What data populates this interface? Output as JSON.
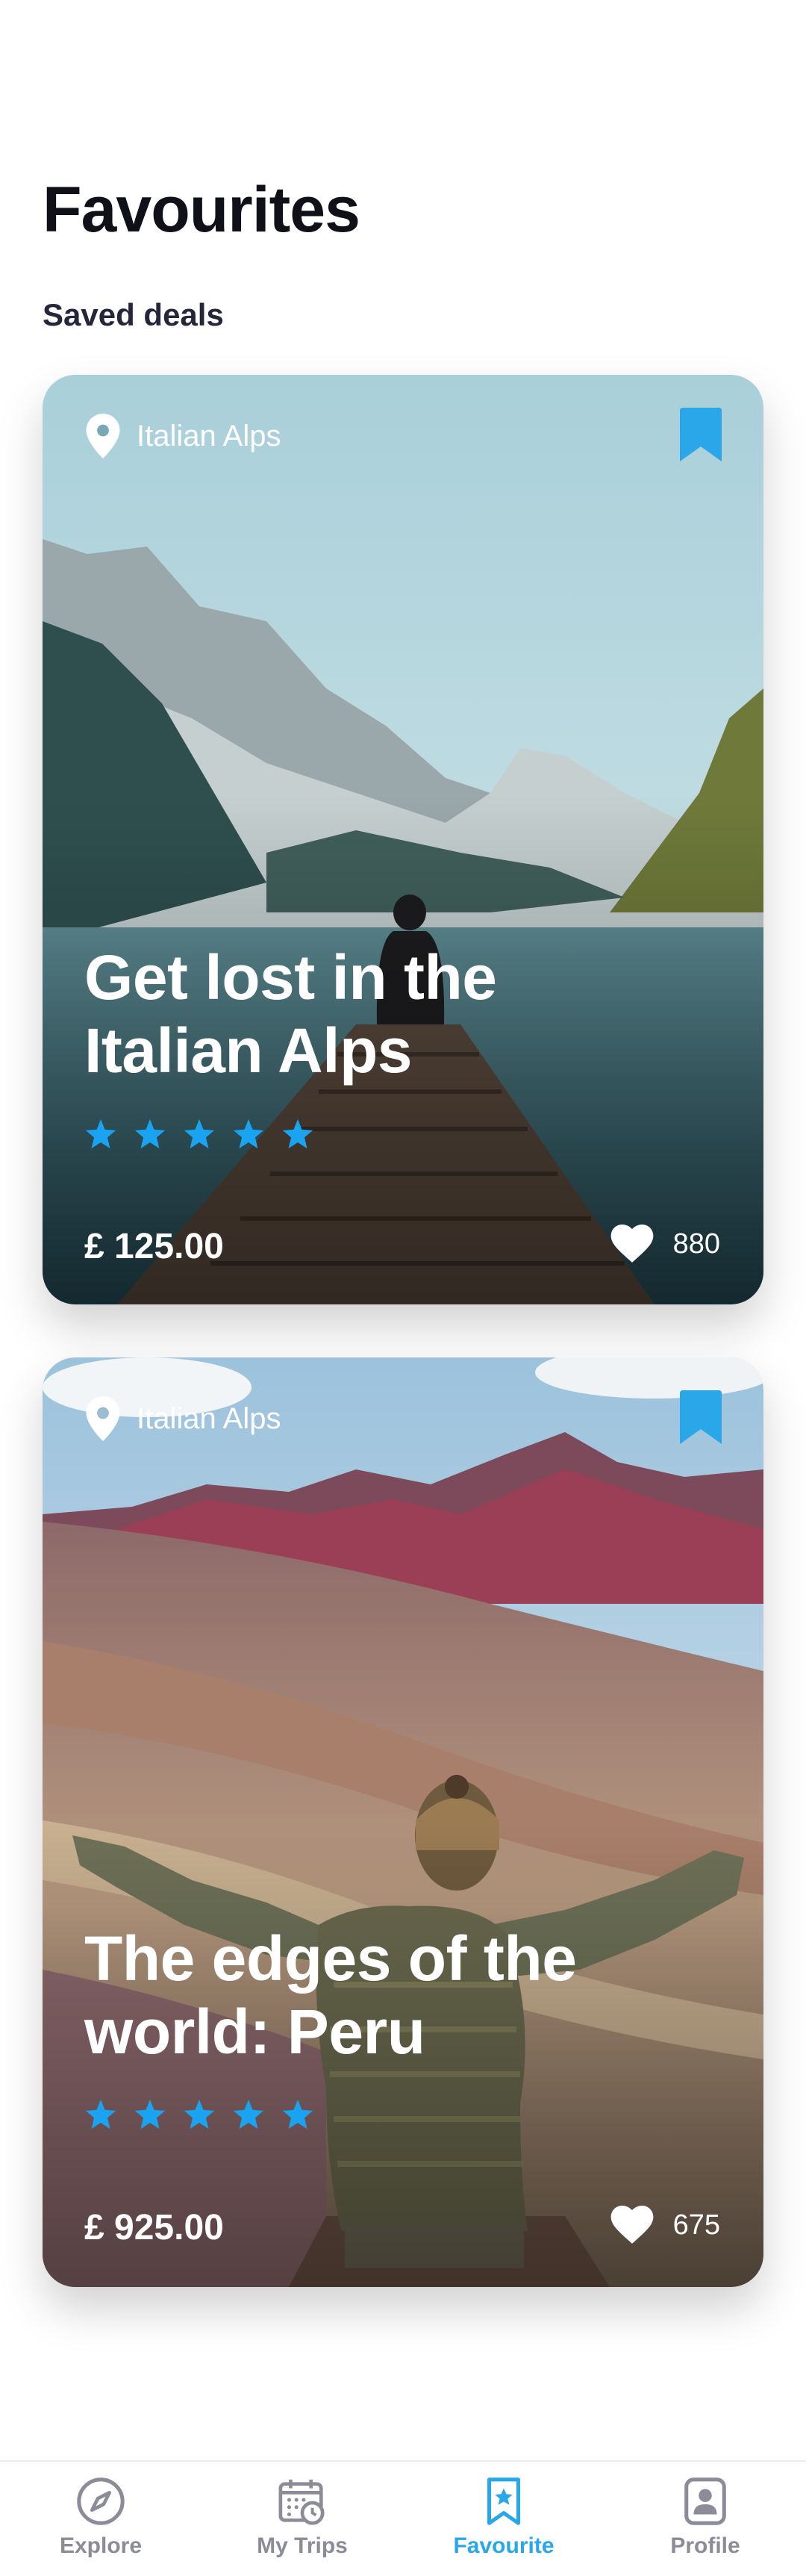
{
  "page": {
    "title": "Favourites",
    "section_title": "Saved deals"
  },
  "deals": [
    {
      "location": "Italian Alps",
      "title": "Get lost in the Italian Alps",
      "rating": 5,
      "price": "£ 125.00",
      "likes": "880",
      "bookmarked": true
    },
    {
      "location": "Italian Alps",
      "title": "The edges of the world: Peru",
      "rating": 5,
      "price": "£ 925.00",
      "likes": "675",
      "bookmarked": true
    }
  ],
  "tabs": [
    {
      "label": "Explore",
      "icon": "compass-icon",
      "active": false
    },
    {
      "label": "My Trips",
      "icon": "calendar-clock-icon",
      "active": false
    },
    {
      "label": "Favourite",
      "icon": "bookmark-star-icon",
      "active": true
    },
    {
      "label": "Profile",
      "icon": "profile-icon",
      "active": false
    }
  ],
  "colors": {
    "accent": "#29a7e8",
    "star": "#1aa3f0",
    "inactive_tab": "#8c8c99"
  }
}
